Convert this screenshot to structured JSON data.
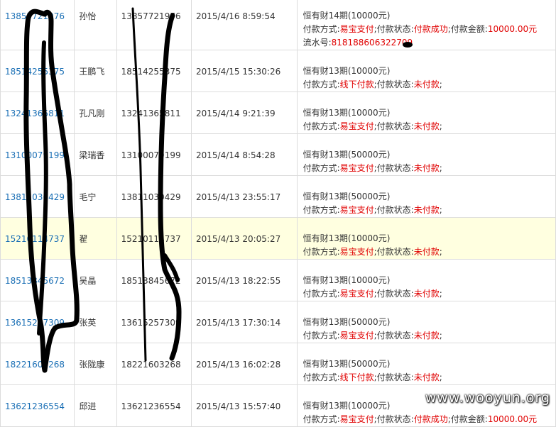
{
  "rows": [
    {
      "phone": "13857721976",
      "name": "孙怡",
      "mobile": "13857721976",
      "time": "2015/4/16 8:59:54",
      "product": "恒有财14期(10000元)",
      "pay_method": "易宝支付",
      "pay_status": "付款成功",
      "amount_label": "付款金额:",
      "amount": "10000.00元",
      "serial_label": "流水号:",
      "serial": "818188606322709",
      "highlight": false
    },
    {
      "phone": "18514255375",
      "name": "王鹏飞",
      "mobile": "18514255375",
      "time": "2015/4/15 15:30:26",
      "product": "恒有财13期(10000元)",
      "pay_method": "线下付款",
      "pay_status": "未付款",
      "highlight": false
    },
    {
      "phone": "13241365811",
      "name": "孔凡刚",
      "mobile": "13241365811",
      "time": "2015/4/14 9:21:39",
      "product": "恒有财13期(10000元)",
      "pay_method": "易宝支付",
      "pay_status": "未付款",
      "highlight": false
    },
    {
      "phone": "13100079199",
      "name": "梁瑞香",
      "mobile": "13100079199",
      "time": "2015/4/14 8:54:28",
      "product": "恒有财13期(50000元)",
      "pay_method": "易宝支付",
      "pay_status": "未付款",
      "highlight": false
    },
    {
      "phone": "13811030429",
      "name": "毛宁",
      "mobile": "13811030429",
      "time": "2015/4/13 23:55:17",
      "product": "恒有财13期(50000元)",
      "pay_method": "易宝支付",
      "pay_status": "未付款",
      "highlight": false
    },
    {
      "phone": "15210114737",
      "name": "翟",
      "mobile": "15210114737",
      "time": "2015/4/13 20:05:27",
      "product": "恒有财13期(10000元)",
      "pay_method": "易宝支付",
      "pay_status": "未付款",
      "highlight": true
    },
    {
      "phone": "18513845672",
      "name": "吴晶",
      "mobile": "18513845672",
      "time": "2015/4/13 18:22:55",
      "product": "恒有财13期(10000元)",
      "pay_method": "易宝支付",
      "pay_status": "未付款",
      "highlight": false
    },
    {
      "phone": "13615257309",
      "name": "张英",
      "mobile": "13615257309",
      "time": "2015/4/13 17:30:14",
      "product": "恒有财13期(50000元)",
      "pay_method": "易宝支付",
      "pay_status": "未付款",
      "highlight": false
    },
    {
      "phone": "18221603268",
      "name": "张陇康",
      "mobile": "18221603268",
      "time": "2015/4/13 16:02:28",
      "product": "恒有财13期(50000元)",
      "pay_method": "线下付款",
      "pay_status": "未付款",
      "highlight": false
    },
    {
      "phone": "13621236554",
      "name": "邱进",
      "mobile": "13621236554",
      "time": "2015/4/13 15:57:40",
      "product": "恒有财13期(10000元)",
      "pay_method": "易宝支付",
      "pay_status": "付款成功",
      "amount_label": "付款金额:",
      "amount": "10000.00元",
      "highlight": false
    }
  ],
  "labels": {
    "pay_method": "付款方式:",
    "pay_status": "付款状态:",
    "sep": ";"
  },
  "watermark": "www.wooyun.org"
}
